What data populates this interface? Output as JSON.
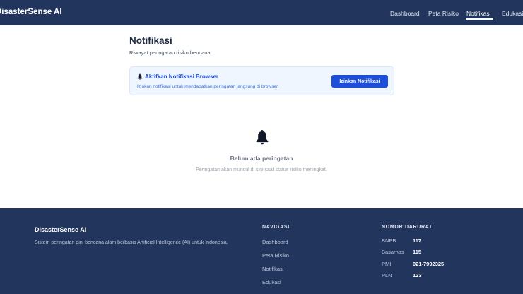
{
  "header": {
    "brand": "DisasterSense AI",
    "nav": [
      {
        "label": "Dashboard"
      },
      {
        "label": "Peta Risiko"
      },
      {
        "label": "Notifikasi",
        "active": true
      },
      {
        "label": "Edukasi"
      }
    ]
  },
  "page": {
    "title": "Notifikasi",
    "subtitle": "Riwayat peringatan risiko bencana"
  },
  "browser_notification_card": {
    "icon": "bell-icon",
    "title": "Aktifkan Notifikasi Browser",
    "description": "Izinkan notifikasi untuk mendapatkan peringatan langsung di browser.",
    "button_label": "Izinkan Notifikasi"
  },
  "empty_state": {
    "icon": "bell-icon",
    "title": "Belum ada peringatan",
    "description": "Peringatan akan muncul di sini saat status risiko meningkat."
  },
  "footer": {
    "brand": "DisasterSense AI",
    "description": "Sistem peringatan dini bencana alam berbasis Artificial Intelligence (AI) untuk Indonesia.",
    "nav_heading": "NAVIGASI",
    "nav_links": [
      "Dashboard",
      "Peta Risiko",
      "Notifikasi",
      "Edukasi"
    ],
    "emergency_heading": "NOMOR DARURAT",
    "emergency": [
      {
        "label": "BNPB",
        "number": "117"
      },
      {
        "label": "Basarnas",
        "number": "115"
      },
      {
        "label": "PMI",
        "number": "021-7992325"
      },
      {
        "label": "PLN",
        "number": "123"
      }
    ]
  },
  "colors": {
    "navbar": "#22365d",
    "accent": "#1d4ed8",
    "card_bg": "#eff6ff"
  }
}
